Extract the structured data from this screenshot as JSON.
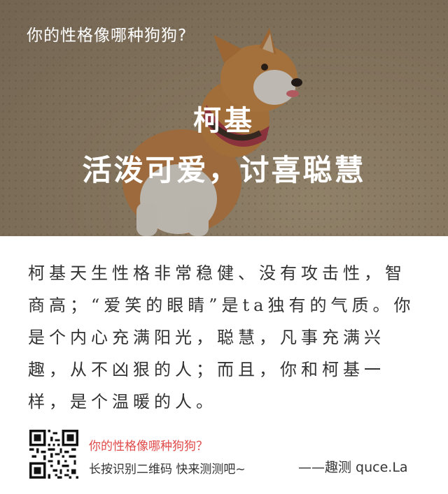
{
  "hero": {
    "quiz_title": "你的性格像哪种狗狗?",
    "breed": "柯基",
    "tagline": "活泼可爱，讨喜聪慧"
  },
  "description": "柯基天生性格非常稳健、没有攻击性，智商高；“爱笑的眼睛”是ta独有的气质。你是个内心充满阳光，聪慧，凡事充满兴趣，从不凶狠的人；而且，你和柯基一样，是个温暖的人。",
  "footer": {
    "title": "你的性格像哪种狗狗？",
    "cta": "长按识别二维码  快来测测吧~",
    "brand": "——趣测 quce.La",
    "qr_icon": "qr-code-icon"
  },
  "colors": {
    "accent_red": "#e04b4b",
    "text": "#333333"
  }
}
